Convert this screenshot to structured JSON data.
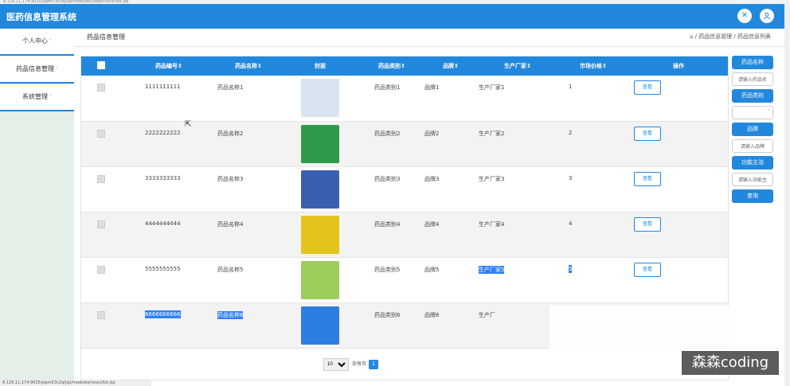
{
  "browser": {
    "url": "8.129.11.174:9025/jspm53n2q/jsp/modules/yaopinxinxi/list.jsp",
    "status_url": "8.129.11.174:9025/jspm53n2q/jsp/modules/news/list.jsp"
  },
  "header": {
    "title": "医药信息管理系统",
    "close_icon": "close-icon",
    "user_icon": "user-icon"
  },
  "sidebar": {
    "items": [
      {
        "label": "个人中心"
      },
      {
        "label": "药品信息管理"
      },
      {
        "label": "系统管理"
      }
    ]
  },
  "main": {
    "page_title": "药品信息管理",
    "breadcrumb": "药品信息管理 / 药品信息列表"
  },
  "table": {
    "headers": [
      "药品编号",
      "药品名称",
      "封面",
      "药品类别",
      "品牌",
      "生产厂家",
      "市场价格",
      "操作"
    ],
    "rows": [
      {
        "code": "1111111111",
        "name": "药品名称1",
        "category": "药品类别1",
        "brand": "品牌1",
        "maker": "生产厂家1",
        "price": "1",
        "cover_color": "#d8e4ef"
      },
      {
        "code": "2222222222",
        "name": "药品名称2",
        "category": "药品类别2",
        "brand": "品牌2",
        "maker": "生产厂家2",
        "price": "2",
        "cover_color": "#2f9a4a"
      },
      {
        "code": "3333333333",
        "name": "药品名称3",
        "category": "药品类别3",
        "brand": "品牌3",
        "maker": "生产厂家3",
        "price": "3",
        "cover_color": "#3a5fb0"
      },
      {
        "code": "4444444444",
        "name": "药品名称4",
        "category": "药品类别4",
        "brand": "品牌4",
        "maker": "生产厂家4",
        "price": "4",
        "cover_color": "#e2c41c"
      },
      {
        "code": "5555555555",
        "name": "药品名称5",
        "category": "药品类别5",
        "brand": "品牌5",
        "maker": "生产厂家5",
        "price": "5",
        "cover_color": "#9ccc5a"
      },
      {
        "code": "6666666666",
        "name": "药品名称6",
        "category": "药品类别6",
        "brand": "品牌6",
        "maker": "生产厂",
        "price": "",
        "cover_color": "#2e7de0"
      }
    ],
    "action_label": "查看"
  },
  "pagination": {
    "page_size": "10",
    "per_page_label": "条每页",
    "current_page": "1"
  },
  "filter": {
    "name_button": "药品名称",
    "name_placeholder": "请输入药品名",
    "category_button": "药品类别",
    "brand_button": "品牌",
    "brand_placeholder": "请输入品牌",
    "function_button": "功能主治",
    "function_placeholder": "请输入功能主",
    "search_button": "查询"
  },
  "watermark": "森森coding",
  "colors": {
    "primary": "#2288dd",
    "sidebar_bg": "#e4efe8",
    "highlight": "#2d7ff9"
  }
}
